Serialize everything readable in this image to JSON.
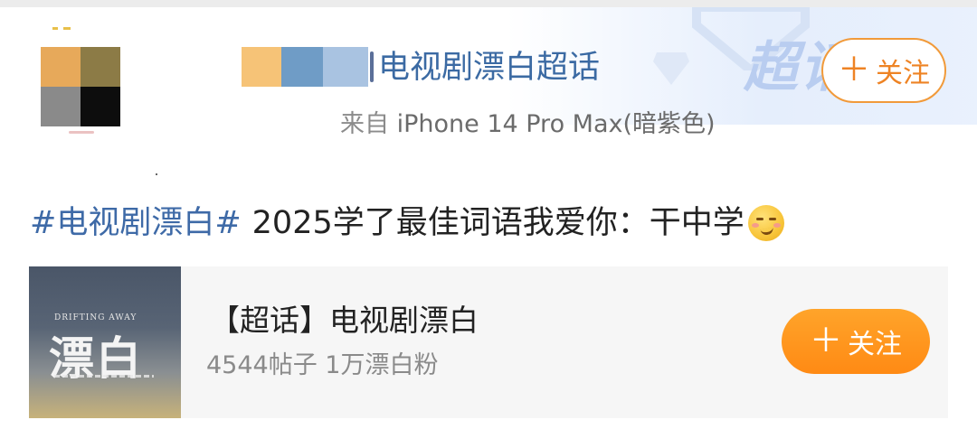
{
  "post": {
    "user_name": "电视剧漂白超话",
    "source_prefix": "来自",
    "source_device": "iPhone 14 Pro Max(暗紫色)",
    "follow_label": "关注",
    "follow_icon": "plus-icon",
    "watermark_text": "超话",
    "avatar_colors": [
      "#e7a95a",
      "#8c7b46",
      "#8a8a8a",
      "#0d0d0d"
    ],
    "name_bar_colors": [
      "#f6c377",
      "#6f9cc6",
      "#a9c3e1"
    ],
    "hashtag": "#电视剧漂白#",
    "text": "2025学了最佳词语我爱你：干中学",
    "emoji": "smirk-emoji"
  },
  "topic_card": {
    "poster_title": "漂白",
    "poster_subtitle": "DRIFTING AWAY",
    "title": "【超话】电视剧漂白",
    "stats": "4544帖子 1万漂白粉",
    "follow_label": "关注",
    "follow_icon": "plus-icon"
  },
  "colors": {
    "link_blue": "#3e6aa7",
    "accent_orange": "#ff8a14",
    "muted_gray": "#8a8a8a"
  }
}
